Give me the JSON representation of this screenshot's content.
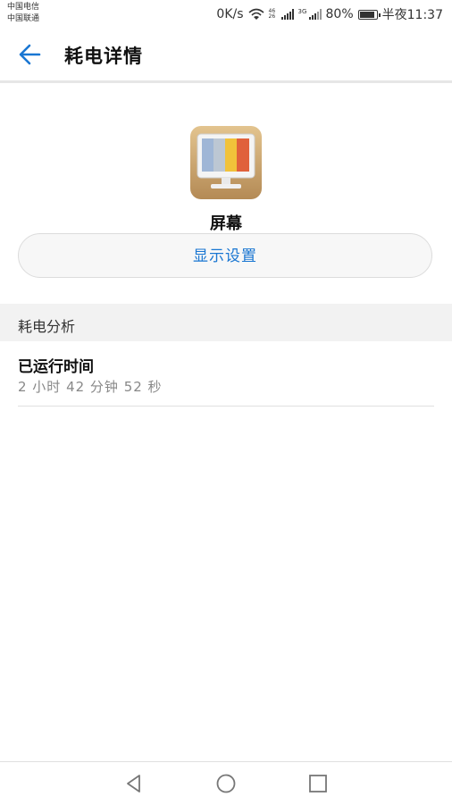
{
  "status_bar": {
    "carrier_1": "中国电信",
    "carrier_2": "中国联通",
    "net_speed": "0K/s",
    "signal_1_label": "46 26",
    "signal_2_label": "3G",
    "battery": "80%",
    "time": "半夜11:37"
  },
  "header": {
    "title": "耗电详情"
  },
  "app": {
    "name": "屏幕",
    "settings_button": "显示设置"
  },
  "section": {
    "title": "耗电分析"
  },
  "runtime": {
    "label": "已运行时间",
    "value": "2 小时 42 分钟 52 秒"
  },
  "icons": {
    "back": "back-arrow-icon",
    "app": "monitor-icon",
    "nav_back": "triangle-back-icon",
    "nav_home": "circle-home-icon",
    "nav_recents": "square-recents-icon"
  },
  "colors": {
    "accent": "#1976d2",
    "section_bg": "#f2f2f2"
  }
}
